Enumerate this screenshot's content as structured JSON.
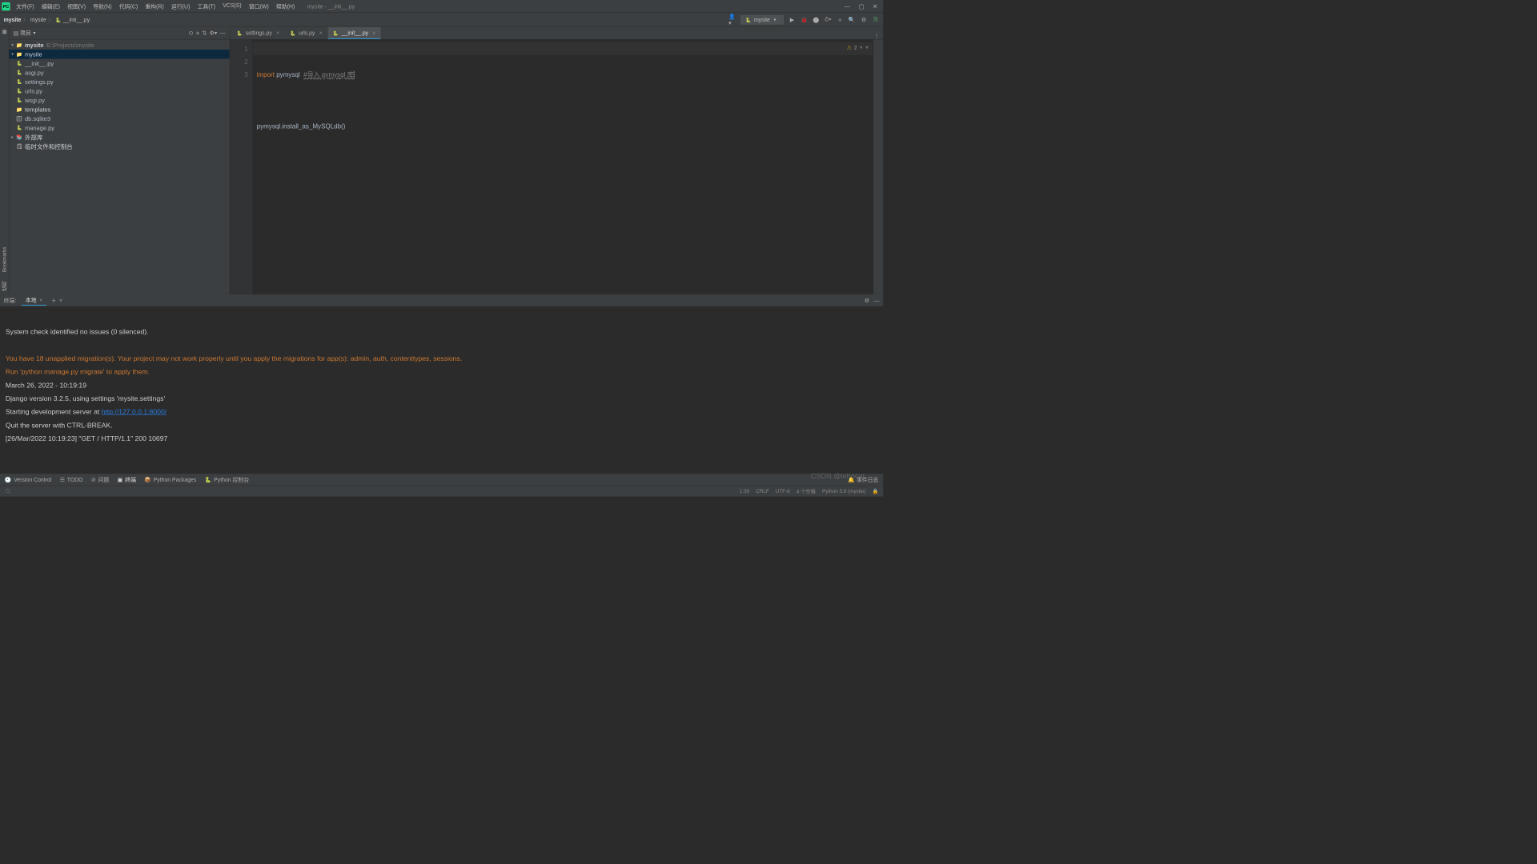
{
  "window": {
    "title": "mysite - __init__.py"
  },
  "menu": [
    "文件(F)",
    "编辑(E)",
    "视图(V)",
    "导航(N)",
    "代码(C)",
    "重构(R)",
    "运行(U)",
    "工具(T)",
    "VCS(S)",
    "窗口(W)",
    "帮助(H)"
  ],
  "breadcrumb": [
    "mysite",
    "mysite",
    "__init__.py"
  ],
  "run_config": {
    "name": "mysite"
  },
  "project_panel": {
    "title": "项目",
    "root": {
      "name": "mysite",
      "path": "E:\\Projects\\mysite"
    },
    "tree": [
      {
        "name": "mysite",
        "selected": true,
        "children": [
          {
            "name": "__init__.py"
          },
          {
            "name": "asgi.py"
          },
          {
            "name": "settings.py"
          },
          {
            "name": "urls.py"
          },
          {
            "name": "wsgi.py"
          }
        ]
      },
      {
        "name": "templates",
        "kind": "folder"
      },
      {
        "name": "db.sqlite3",
        "kind": "db"
      },
      {
        "name": "manage.py",
        "kind": "py"
      }
    ],
    "extras": [
      "外部库",
      "临时文件和控制台"
    ]
  },
  "tabs": [
    {
      "label": "settings.py",
      "active": false
    },
    {
      "label": "urls.py",
      "active": false
    },
    {
      "label": "__init__.py",
      "active": true
    }
  ],
  "inspection": {
    "warnings": 2,
    "label": "⚠"
  },
  "code": {
    "lines": [
      "1",
      "2",
      "3"
    ],
    "l1_kw": "import",
    "l1_id": " pymysql  ",
    "l1_cm": "#导入 pymysql 库",
    "l3": "pymysql.install_as_MySQLdb()"
  },
  "terminal": {
    "title": "终端:",
    "tab": "本地",
    "lines": [
      "",
      "System check identified no issues (0 silenced).",
      "",
      "You have 18 unapplied migration(s). Your project may not work properly until you apply the migrations for app(s): admin, auth, contenttypes, sessions.",
      "Run 'python manage.py migrate' to apply them.",
      "March 26, 2022 - 10:19:19",
      "Django version 3.2.5, using settings 'mysite.settings'",
      "Starting development server at ",
      "http://127.0.0.1:8000/",
      "Quit the server with CTRL-BREAK.",
      "[26/Mar/2022 10:19:23] \"GET / HTTP/1.1\" 200 10697"
    ]
  },
  "bottom_tools": {
    "items": [
      "Version Control",
      "TODO",
      "问题",
      "终端",
      "Python Packages",
      "Python 控制台"
    ],
    "active": "终端",
    "event_log": "事件日志"
  },
  "status": {
    "pos": "1:30",
    "eol": "CRLF",
    "enc": "UTF-8",
    "indent": "4 个空格",
    "interp": "Python 3.9 (mysite)",
    "watermark": "CSDN @lehocat"
  },
  "side_labels": {
    "bookmarks": "Bookmarks",
    "structure": "结构"
  }
}
